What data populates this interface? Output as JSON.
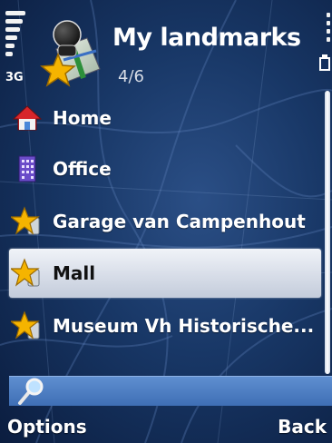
{
  "status": {
    "network_label": "3G"
  },
  "header": {
    "title": "My landmarks",
    "counter": "4/6",
    "app_icon": "landmarks-app-icon"
  },
  "list": {
    "items": [
      {
        "label": "Home",
        "icon": "home-icon",
        "selected": false
      },
      {
        "label": "Office",
        "icon": "office-building-icon",
        "selected": false
      },
      {
        "label": "Garage van Campenhout",
        "icon": "landmark-star-icon",
        "selected": false
      },
      {
        "label": "Mall",
        "icon": "landmark-star-icon",
        "selected": true
      },
      {
        "label": "Museum Vh Historische...",
        "icon": "landmark-star-icon",
        "selected": false
      }
    ]
  },
  "search": {
    "icon": "magnifier-icon",
    "value": ""
  },
  "softkeys": {
    "left": "Options",
    "right": "Back"
  },
  "colors": {
    "background": "#183766",
    "selection": "#d7dde8",
    "search_field": "#4f7fc3",
    "text": "#ffffff"
  }
}
